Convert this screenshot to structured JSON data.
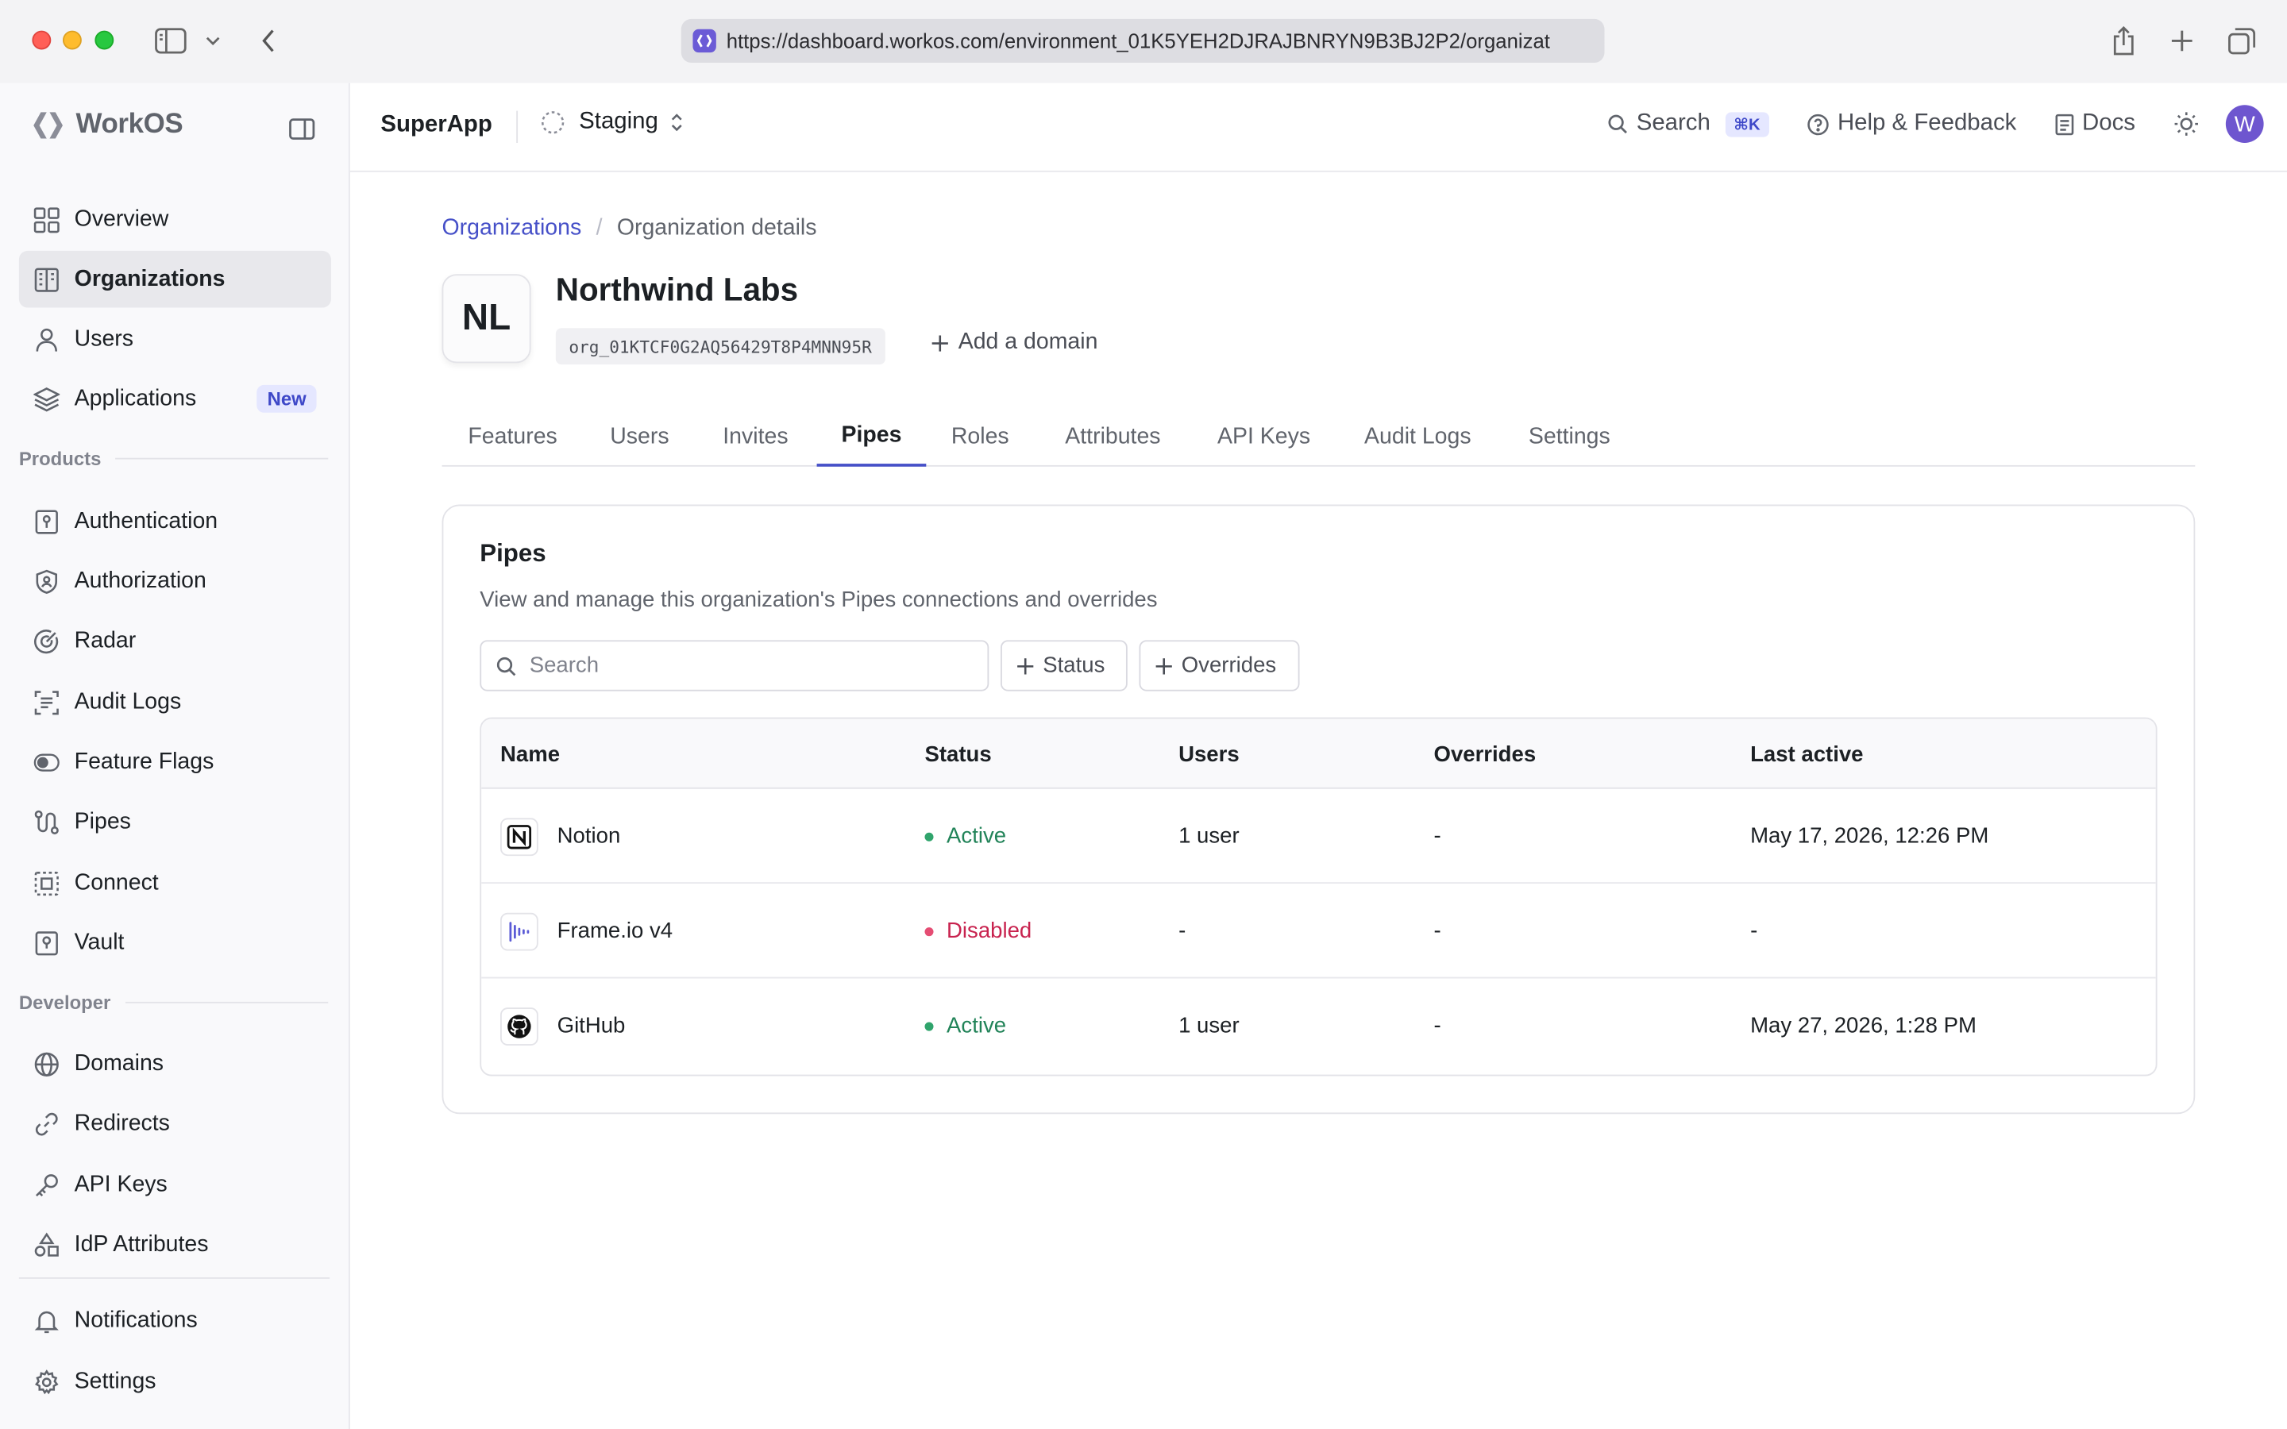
{
  "browser": {
    "url": "https://dashboard.workos.com/environment_01K5YEH2DJRAJBNRYN9B3BJ2P2/organizat"
  },
  "sidebar": {
    "logo": "WorkOS",
    "items": [
      {
        "label": "Overview",
        "icon": "grid-icon"
      },
      {
        "label": "Organizations",
        "icon": "building-icon",
        "active": true
      },
      {
        "label": "Users",
        "icon": "user-icon"
      },
      {
        "label": "Applications",
        "icon": "layers-icon",
        "badge": "New"
      }
    ],
    "products_label": "Products",
    "products": [
      {
        "label": "Authentication",
        "icon": "key-panel-icon"
      },
      {
        "label": "Authorization",
        "icon": "shield-icon"
      },
      {
        "label": "Radar",
        "icon": "radar-icon"
      },
      {
        "label": "Audit Logs",
        "icon": "log-icon"
      },
      {
        "label": "Feature Flags",
        "icon": "toggle-icon"
      },
      {
        "label": "Pipes",
        "icon": "pipes-icon"
      },
      {
        "label": "Connect",
        "icon": "connect-icon"
      },
      {
        "label": "Vault",
        "icon": "vault-icon"
      }
    ],
    "developer_label": "Developer",
    "developer": [
      {
        "label": "Domains",
        "icon": "globe-icon"
      },
      {
        "label": "Redirects",
        "icon": "link-icon"
      },
      {
        "label": "API Keys",
        "icon": "key-icon"
      },
      {
        "label": "IdP Attributes",
        "icon": "shapes-icon"
      }
    ],
    "bottom": [
      {
        "label": "Notifications",
        "icon": "bell-icon"
      },
      {
        "label": "Settings",
        "icon": "gear-icon"
      }
    ]
  },
  "topbar": {
    "app_name": "SuperApp",
    "environment": "Staging",
    "search_label": "Search",
    "search_shortcut": "⌘K",
    "help_label": "Help & Feedback",
    "docs_label": "Docs",
    "avatar_initial": "W"
  },
  "breadcrumb": {
    "parent": "Organizations",
    "current": "Organization details"
  },
  "organization": {
    "initials": "NL",
    "name": "Northwind Labs",
    "id": "org_01KTCF0G2AQ56429T8P4MNN95R",
    "add_domain_label": "Add a domain"
  },
  "tabs": [
    {
      "label": "Features"
    },
    {
      "label": "Users"
    },
    {
      "label": "Invites"
    },
    {
      "label": "Pipes",
      "active": true
    },
    {
      "label": "Roles"
    },
    {
      "label": "Attributes"
    },
    {
      "label": "API Keys"
    },
    {
      "label": "Audit Logs"
    },
    {
      "label": "Settings"
    }
  ],
  "pipes": {
    "title": "Pipes",
    "description": "View and manage this organization's Pipes connections and overrides",
    "search_placeholder": "Search",
    "filter_status": "Status",
    "filter_overrides": "Overrides",
    "columns": {
      "name": "Name",
      "status": "Status",
      "users": "Users",
      "overrides": "Overrides",
      "last_active": "Last active"
    },
    "rows": [
      {
        "name": "Notion",
        "icon": "notion-icon",
        "status": "Active",
        "status_color": "#30a46c",
        "users": "1 user",
        "overrides": "-",
        "last_active": "May 17, 2026, 12:26 PM"
      },
      {
        "name": "Frame.io v4",
        "icon": "frameio-icon",
        "status": "Disabled",
        "status_color": "#dc3e6e",
        "users": "-",
        "overrides": "-",
        "last_active": "-"
      },
      {
        "name": "GitHub",
        "icon": "github-icon",
        "status": "Active",
        "status_color": "#30a46c",
        "users": "1 user",
        "overrides": "-",
        "last_active": "May 27, 2026, 1:28 PM"
      }
    ]
  },
  "colors": {
    "accent": "#4650c8",
    "active_status": "#30a46c",
    "disabled_status": "#dc3e6e"
  }
}
